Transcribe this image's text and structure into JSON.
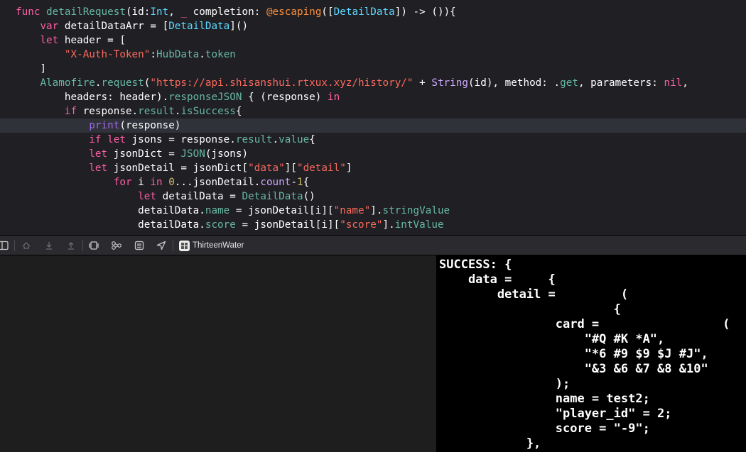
{
  "editor": {
    "code": [
      {
        "tokens": [
          [
            "kw",
            "func "
          ],
          [
            "fn",
            "detailRequest"
          ],
          [
            "pl",
            "(id:"
          ],
          [
            "ty",
            "Int"
          ],
          [
            "pl",
            ", "
          ],
          [
            "kw",
            "_"
          ],
          [
            "pl",
            " completion: "
          ],
          [
            "at",
            "@escaping"
          ],
          [
            "pl",
            "(["
          ],
          [
            "ty",
            "DetailData"
          ],
          [
            "pl",
            "]) -> ()){"
          ]
        ]
      },
      {
        "tokens": [
          [
            "pl",
            "    "
          ],
          [
            "kw",
            "var"
          ],
          [
            "pl",
            " detailDataArr = ["
          ],
          [
            "ty",
            "DetailData"
          ],
          [
            "pl",
            "]()"
          ]
        ]
      },
      {
        "tokens": [
          [
            "pl",
            "    "
          ],
          [
            "kw",
            "let"
          ],
          [
            "pl",
            " header = ["
          ]
        ]
      },
      {
        "tokens": [
          [
            "pl",
            "        "
          ],
          [
            "st",
            "\"X-Auth-Token\""
          ],
          [
            "pl",
            ":"
          ],
          [
            "mb",
            "HubData"
          ],
          [
            "pl",
            "."
          ],
          [
            "mb",
            "token"
          ]
        ]
      },
      {
        "tokens": [
          [
            "pl",
            "    ]"
          ]
        ]
      },
      {
        "tokens": [
          [
            "pl",
            "    "
          ],
          [
            "mb",
            "Alamofire"
          ],
          [
            "pl",
            "."
          ],
          [
            "mb",
            "request"
          ],
          [
            "pl",
            "("
          ],
          [
            "st",
            "\"https://api.shisanshui.rtxux.xyz/history/\""
          ],
          [
            "pl",
            " + "
          ],
          [
            "tp",
            "String"
          ],
          [
            "pl",
            "(id), method: ."
          ],
          [
            "mb",
            "get"
          ],
          [
            "pl",
            ", parameters: "
          ],
          [
            "kw",
            "nil"
          ],
          [
            "pl",
            ","
          ]
        ]
      },
      {
        "tokens": [
          [
            "pl",
            "        headers: header)."
          ],
          [
            "mb",
            "responseJSON"
          ],
          [
            "pl",
            " { (response) "
          ],
          [
            "kw",
            "in"
          ]
        ]
      },
      {
        "tokens": [
          [
            "pl",
            "        "
          ],
          [
            "kw",
            "if"
          ],
          [
            "pl",
            " response."
          ],
          [
            "mb",
            "result"
          ],
          [
            "pl",
            "."
          ],
          [
            "mb",
            "isSuccess"
          ],
          [
            "pl",
            "{"
          ]
        ]
      },
      {
        "tokens": [
          [
            "pl",
            "            "
          ],
          [
            "pr",
            "print"
          ],
          [
            "pl",
            "(response)"
          ]
        ],
        "current": true
      },
      {
        "tokens": [
          [
            "pl",
            "            "
          ],
          [
            "kw",
            "if let"
          ],
          [
            "pl",
            " jsons = response."
          ],
          [
            "mb",
            "result"
          ],
          [
            "pl",
            "."
          ],
          [
            "mb",
            "value"
          ],
          [
            "pl",
            "{"
          ]
        ]
      },
      {
        "tokens": [
          [
            "pl",
            "            "
          ],
          [
            "kw",
            "let"
          ],
          [
            "pl",
            " jsonDict = "
          ],
          [
            "mb",
            "JSON"
          ],
          [
            "pl",
            "(jsons)"
          ]
        ]
      },
      {
        "tokens": [
          [
            "pl",
            "            "
          ],
          [
            "kw",
            "let"
          ],
          [
            "pl",
            " jsonDetail = jsonDict["
          ],
          [
            "st",
            "\"data\""
          ],
          [
            "pl",
            "]["
          ],
          [
            "st",
            "\"detail\""
          ],
          [
            "pl",
            "]"
          ]
        ]
      },
      {
        "tokens": [
          [
            "pl",
            "                "
          ],
          [
            "kw",
            "for"
          ],
          [
            "pl",
            " i "
          ],
          [
            "kw",
            "in"
          ],
          [
            "pl",
            " "
          ],
          [
            "nm",
            "0"
          ],
          [
            "pl",
            "...jsonDetail."
          ],
          [
            "tp",
            "count"
          ],
          [
            "pl",
            "-"
          ],
          [
            "nm",
            "1"
          ],
          [
            "pl",
            "{"
          ]
        ]
      },
      {
        "tokens": [
          [
            "pl",
            "                    "
          ],
          [
            "kw",
            "let"
          ],
          [
            "pl",
            " detailData = "
          ],
          [
            "mb",
            "DetailData"
          ],
          [
            "pl",
            "()"
          ]
        ]
      },
      {
        "tokens": [
          [
            "pl",
            "                    detailData."
          ],
          [
            "mb",
            "name"
          ],
          [
            "pl",
            " = jsonDetail[i]["
          ],
          [
            "st",
            "\"name\""
          ],
          [
            "pl",
            "]."
          ],
          [
            "mb",
            "stringValue"
          ]
        ]
      },
      {
        "tokens": [
          [
            "pl",
            "                    detailData."
          ],
          [
            "mb",
            "score"
          ],
          [
            "pl",
            " = jsonDetail[i]["
          ],
          [
            "st",
            "\"score\""
          ],
          [
            "pl",
            "]."
          ],
          [
            "mb",
            "intValue"
          ]
        ]
      }
    ]
  },
  "toolbar": {
    "icons": [
      "hide-debug-area-icon",
      "continue-icon",
      "step-over-icon",
      "step-into-icon",
      "step-out-icon",
      "debug-view-hierarchy-icon",
      "memory-graph-icon",
      "environment-overrides-icon",
      "simulate-location-icon"
    ],
    "target_name": "ThirteenWater"
  },
  "console": {
    "lines": [
      "SUCCESS: {",
      "    data =     {",
      "        detail =         (",
      "                        {",
      "                card =                 (",
      "                    \"#Q #K *A\",",
      "                    \"*6 #9 $9 $J #J\",",
      "                    \"&3 &6 &7 &8 &10\"",
      "                );",
      "                name = test2;",
      "                \"player_id\" = 2;",
      "                score = \"-9\";",
      "            },"
    ]
  }
}
